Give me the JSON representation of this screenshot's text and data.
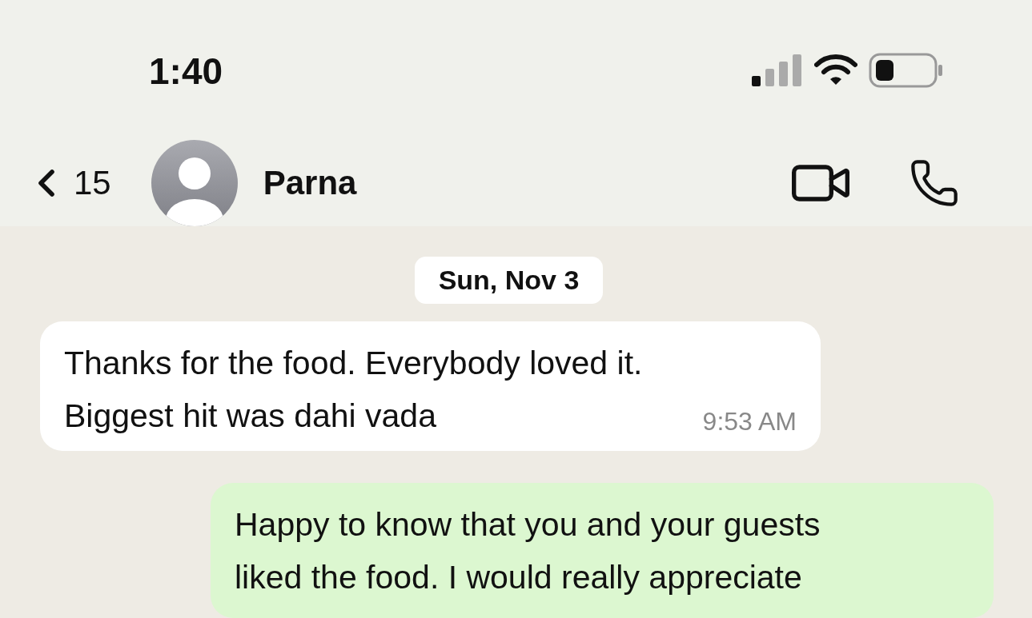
{
  "status_bar": {
    "time": "1:40"
  },
  "header": {
    "back_count": "15",
    "contact_name": "Parna"
  },
  "date_label": "Sun, Nov 3",
  "messages": [
    {
      "kind": "incoming",
      "text": "Thanks for the food. Everybody loved it.\nBiggest hit was dahi vada",
      "time": "9:53 AM"
    },
    {
      "kind": "outgoing",
      "text": "Happy to know that you and your guests\nliked the food. I would really appreciate"
    }
  ]
}
